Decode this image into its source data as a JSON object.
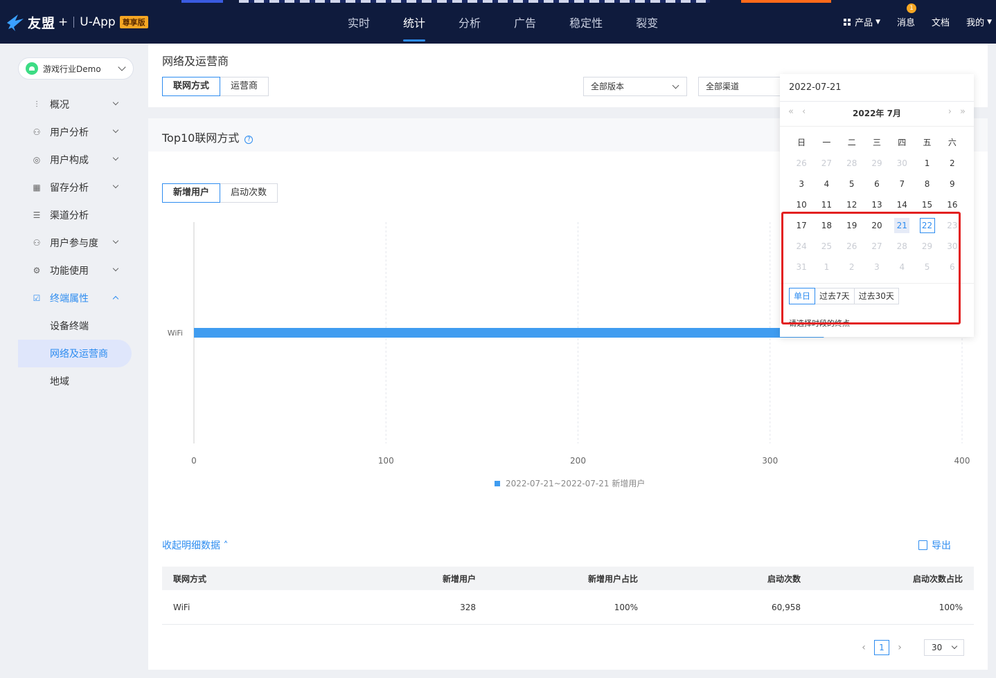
{
  "header": {
    "brand": "友盟",
    "plus": "+",
    "product": "U-App",
    "badge": "尊享版",
    "nav": [
      "实时",
      "统计",
      "分析",
      "广告",
      "稳定性",
      "裂变"
    ],
    "nav_active_index": 1,
    "right": {
      "products": "产品",
      "messages": "消息",
      "message_count": "1",
      "docs": "文档",
      "mine": "我的"
    }
  },
  "sidebar": {
    "app_name": "游戏行业Demo",
    "menu": [
      {
        "label": "概况",
        "icon": "overview-icon",
        "expandable": true
      },
      {
        "label": "用户分析",
        "icon": "user-analysis-icon",
        "expandable": true
      },
      {
        "label": "用户构成",
        "icon": "user-composition-icon",
        "expandable": true
      },
      {
        "label": "留存分析",
        "icon": "retention-icon",
        "expandable": true
      },
      {
        "label": "渠道分析",
        "icon": "channel-icon",
        "expandable": false
      },
      {
        "label": "用户参与度",
        "icon": "engagement-icon",
        "expandable": true
      },
      {
        "label": "功能使用",
        "icon": "feature-icon",
        "expandable": true
      },
      {
        "label": "终端属性",
        "icon": "terminal-icon",
        "expandable": true,
        "open": true
      }
    ],
    "submenu": [
      "设备终端",
      "网络及运营商",
      "地域"
    ],
    "submenu_active_index": 1
  },
  "filters": {
    "page_title": "网络及运营商",
    "tabs": [
      "联网方式",
      "运营商"
    ],
    "active_tab": 0,
    "version_select": "全部版本",
    "channel_select": "全部渠道"
  },
  "chart_section": {
    "title": "Top10联网方式",
    "metric_tabs": [
      "新增用户",
      "启动次数"
    ],
    "active_metric": 0
  },
  "chart_data": {
    "type": "bar",
    "orientation": "horizontal",
    "categories": [
      "WiFi"
    ],
    "series": [
      {
        "name": "2022-07-21~2022-07-21 新增用户",
        "values": [
          328
        ]
      }
    ],
    "x_ticks": [
      "0",
      "100",
      "200",
      "300",
      "400"
    ],
    "xlim": [
      0,
      400
    ],
    "color": "#3f9cf0",
    "grid": true,
    "legend": "bottom"
  },
  "detail": {
    "collapse_label": "收起明细数据",
    "export_label": "导出",
    "columns": [
      "联网方式",
      "新增用户",
      "新增用户占比",
      "启动次数",
      "启动次数占比"
    ],
    "rows": [
      [
        "WiFi",
        "328",
        "100%",
        "60,958",
        "100%"
      ]
    ],
    "page": "1",
    "page_size": "30"
  },
  "datepicker": {
    "value": "2022-07-21",
    "title": "2022年 7月",
    "weekdays": [
      "日",
      "一",
      "二",
      "三",
      "四",
      "五",
      "六"
    ],
    "weeks": [
      [
        [
          "26",
          "m"
        ],
        [
          "27",
          "m"
        ],
        [
          "28",
          "m"
        ],
        [
          "29",
          "m"
        ],
        [
          "30",
          "m"
        ],
        [
          "1",
          ""
        ],
        [
          "2",
          ""
        ]
      ],
      [
        [
          "3",
          ""
        ],
        [
          "4",
          ""
        ],
        [
          "5",
          ""
        ],
        [
          "6",
          ""
        ],
        [
          "7",
          ""
        ],
        [
          "8",
          ""
        ],
        [
          "9",
          ""
        ]
      ],
      [
        [
          "10",
          ""
        ],
        [
          "11",
          ""
        ],
        [
          "12",
          ""
        ],
        [
          "13",
          ""
        ],
        [
          "14",
          ""
        ],
        [
          "15",
          ""
        ],
        [
          "16",
          ""
        ]
      ],
      [
        [
          "17",
          ""
        ],
        [
          "18",
          ""
        ],
        [
          "19",
          ""
        ],
        [
          "20",
          ""
        ],
        [
          "21",
          "range"
        ],
        [
          "22",
          "today"
        ],
        [
          "23",
          "m"
        ]
      ],
      [
        [
          "24",
          "m"
        ],
        [
          "25",
          "m"
        ],
        [
          "26",
          "m"
        ],
        [
          "27",
          "m"
        ],
        [
          "28",
          "m"
        ],
        [
          "29",
          "m"
        ],
        [
          "30",
          "m"
        ]
      ],
      [
        [
          "31",
          "m"
        ],
        [
          "1",
          "m"
        ],
        [
          "2",
          "m"
        ],
        [
          "3",
          "m"
        ],
        [
          "4",
          "m"
        ],
        [
          "5",
          "m"
        ],
        [
          "6",
          "m"
        ]
      ]
    ],
    "quick": [
      "单日",
      "过去7天",
      "过去30天"
    ],
    "quick_active": 0,
    "hint": "请选择时段的终点",
    "highlight_color": "#e32020"
  }
}
